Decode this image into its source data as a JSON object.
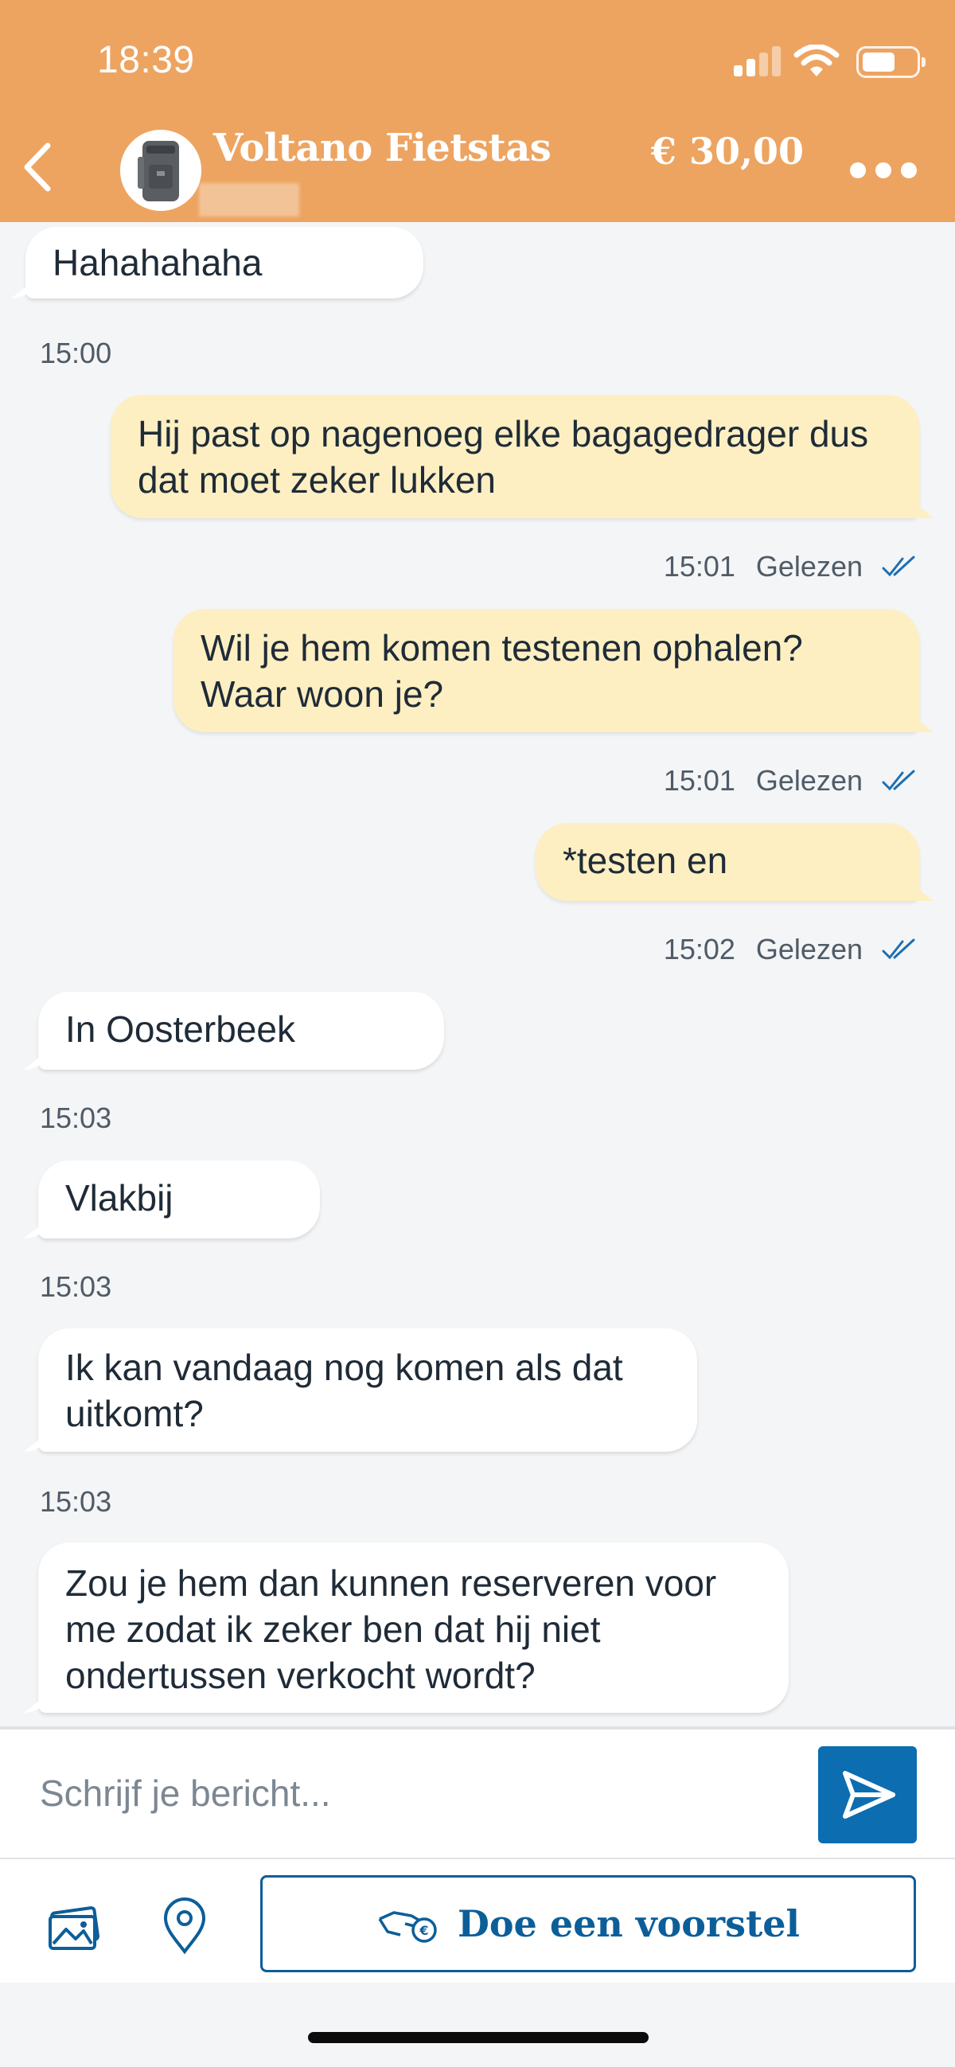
{
  "status_bar": {
    "time": "18:39"
  },
  "header": {
    "title": "Voltano Fietstas",
    "price": "€ 30,00"
  },
  "messages": [
    {
      "direction": "in",
      "text": "Hahahahaha"
    },
    {
      "direction": "in-time",
      "time": "15:00"
    },
    {
      "direction": "out",
      "text": "Hij past op nagenoeg elke bagagedrager dus dat moet zeker lukken",
      "time": "15:01",
      "status": "Gelezen"
    },
    {
      "direction": "out",
      "text": "Wil je hem komen testenen ophalen? Waar woon je?",
      "time": "15:01",
      "status": "Gelezen"
    },
    {
      "direction": "out",
      "text": "*testen en",
      "time": "15:02",
      "status": "Gelezen"
    },
    {
      "direction": "in",
      "text": "In Oosterbeek",
      "time": "15:03"
    },
    {
      "direction": "in",
      "text": "Vlakbij",
      "time": "15:03"
    },
    {
      "direction": "in",
      "text": "Ik kan vandaag nog komen als dat uitkomt?",
      "time": "15:03"
    },
    {
      "direction": "in",
      "text": "Zou je hem dan kunnen reserveren voor me zodat ik zeker ben dat hij niet ondertussen verkocht wordt?"
    }
  ],
  "composer": {
    "placeholder": "Schrijf je bericht..."
  },
  "toolbar": {
    "offer_label": "Doe een voorstel"
  },
  "icons": {
    "back": "chevron-left-icon",
    "more": "more-horizontal-icon",
    "send": "send-icon",
    "photos": "images-icon",
    "location": "map-pin-icon",
    "offer": "hand-offer-icon",
    "read": "double-check-icon"
  },
  "colors": {
    "header": "#eda461",
    "outgoing_bubble": "#fdefc2",
    "incoming_bubble": "#ffffff",
    "accent": "#0c6db1"
  }
}
